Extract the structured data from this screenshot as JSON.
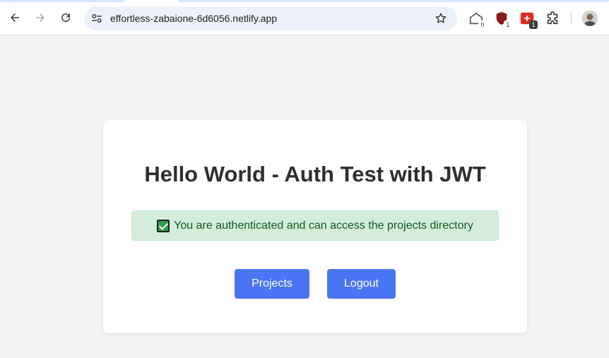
{
  "browser": {
    "url": "effortless-zabaione-6d6056.netlify.app",
    "extensions": [
      {
        "icon": "home-extension-icon",
        "badge": "0",
        "color": "#5f6368"
      },
      {
        "icon": "shield-extension-icon",
        "badge": "1",
        "color": "#8b1a1a"
      },
      {
        "icon": "plus-extension-icon",
        "badge": "1",
        "color": "#d93025"
      }
    ]
  },
  "page": {
    "title": "Hello World - Auth Test with JWT",
    "status_message": "You are authenticated and can access the projects directory",
    "projects_label": "Projects",
    "logout_label": "Logout"
  },
  "colors": {
    "accent": "#4a76f5",
    "success_bg": "#d4edda",
    "success_text": "#155724",
    "page_bg": "#f4f4f4"
  }
}
